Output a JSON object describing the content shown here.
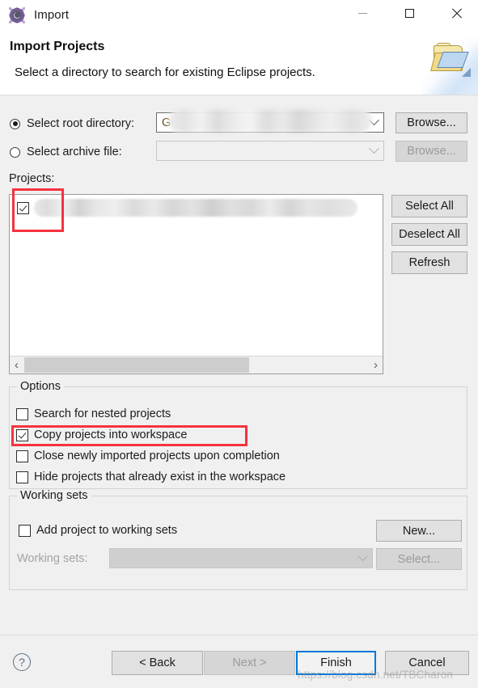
{
  "window": {
    "title": "Import",
    "icon": "eclipse-import-icon",
    "controls": {
      "minimize": "minimize-icon",
      "maximize": "maximize-icon",
      "close": "close-icon"
    }
  },
  "header": {
    "title": "Import Projects",
    "description": "Select a directory to search for existing Eclipse projects.",
    "art_icon": "folder-import-icon"
  },
  "source": {
    "root_directory": {
      "radio_label": "Select root directory:",
      "selected": true,
      "value": "G",
      "value_redacted": true,
      "browse_label": "Browse...",
      "browse_enabled": true
    },
    "archive_file": {
      "radio_label": "Select archive file:",
      "selected": false,
      "value": "",
      "browse_label": "Browse...",
      "browse_enabled": false
    }
  },
  "projects": {
    "label": "Projects:",
    "items": [
      {
        "checked": true,
        "name_redacted": true,
        "name": ""
      }
    ],
    "buttons": {
      "select_all": "Select All",
      "deselect_all": "Deselect All",
      "refresh": "Refresh"
    },
    "scrollbar": {
      "left_arrow": "chevron-left-icon",
      "right_arrow": "chevron-right-icon"
    }
  },
  "options": {
    "group_label": "Options",
    "items": [
      {
        "label": "Search for nested projects",
        "checked": false,
        "highlighted": false
      },
      {
        "label": "Copy projects into workspace",
        "checked": true,
        "highlighted": true
      },
      {
        "label": "Close newly imported projects upon completion",
        "checked": false,
        "highlighted": false
      },
      {
        "label": "Hide projects that already exist in the workspace",
        "checked": false,
        "highlighted": false
      }
    ]
  },
  "working_sets": {
    "group_label": "Working sets",
    "add_checkbox_label": "Add project to working sets",
    "add_checked": false,
    "new_button": "New...",
    "new_enabled": true,
    "combo_label": "Working sets:",
    "combo_value": "",
    "combo_enabled": false,
    "select_button": "Select...",
    "select_enabled": false
  },
  "footer": {
    "help_icon": "help-icon",
    "back": "< Back",
    "back_enabled": true,
    "next": "Next >",
    "next_enabled": false,
    "finish": "Finish",
    "finish_default": true,
    "cancel": "Cancel",
    "watermark": "https://blog.csdn.net/TBCharon"
  },
  "colors": {
    "highlight": "#f5333f",
    "default_button_border": "#0078d7",
    "dialog_background": "#f0f0f0"
  }
}
